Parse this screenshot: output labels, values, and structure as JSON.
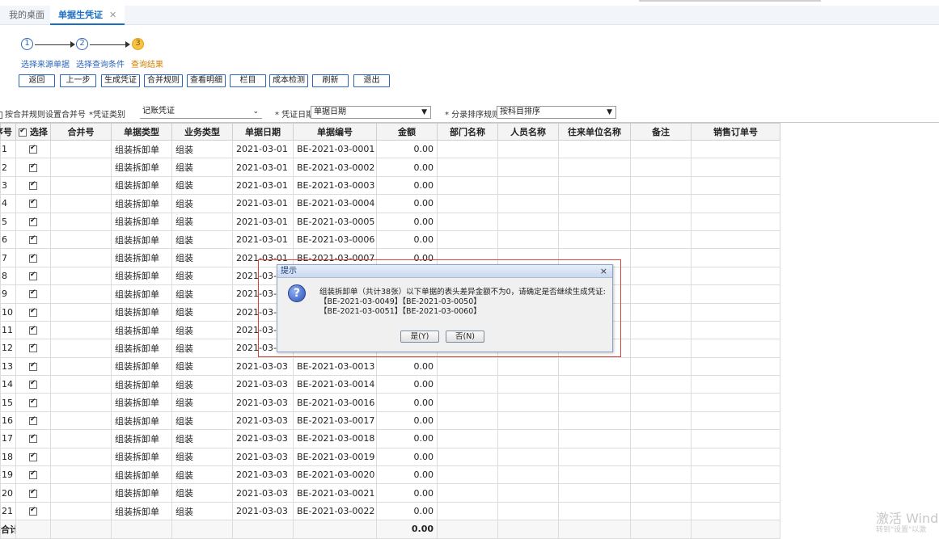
{
  "tabs": [
    {
      "label": "我的桌面"
    },
    {
      "label": "单据生凭证",
      "close": "✕"
    }
  ],
  "steps": [
    {
      "num": "1",
      "label": "选择来源单据"
    },
    {
      "num": "2",
      "label": "选择查询条件"
    },
    {
      "num": "3",
      "label": "查询结果"
    }
  ],
  "toolbar": {
    "back": "返回",
    "prev": "上一步",
    "generate": "生成凭证",
    "merge_rule": "合并规则",
    "view_detail": "查看明细",
    "columns": "栏目",
    "cost_check": "成本检测",
    "refresh": "刷新",
    "exit": "退出"
  },
  "filters": {
    "merge_label": "按合并规则设置合并号",
    "voucher_type_label": "*凭证类别",
    "voucher_type_value": "记账凭证",
    "voucher_date_label": "* 凭证日期",
    "voucher_date_value": "单据日期",
    "sort_label": "* 分录排序规则",
    "sort_value": "按科目排序"
  },
  "table": {
    "headers": [
      "序号",
      "选择",
      "合并号",
      "单据类型",
      "业务类型",
      "单据日期",
      "单据编号",
      "金额",
      "部门名称",
      "人员名称",
      "往来单位名称",
      "备注",
      "销售订单号"
    ],
    "rows": [
      {
        "no": "1",
        "type": "组装拆卸单",
        "biz": "组装",
        "date": "2021-03-01",
        "code": "BE-2021-03-0001",
        "amount": "0.00"
      },
      {
        "no": "2",
        "type": "组装拆卸单",
        "biz": "组装",
        "date": "2021-03-01",
        "code": "BE-2021-03-0002",
        "amount": "0.00"
      },
      {
        "no": "3",
        "type": "组装拆卸单",
        "biz": "组装",
        "date": "2021-03-01",
        "code": "BE-2021-03-0003",
        "amount": "0.00"
      },
      {
        "no": "4",
        "type": "组装拆卸单",
        "biz": "组装",
        "date": "2021-03-01",
        "code": "BE-2021-03-0004",
        "amount": "0.00"
      },
      {
        "no": "5",
        "type": "组装拆卸单",
        "biz": "组装",
        "date": "2021-03-01",
        "code": "BE-2021-03-0005",
        "amount": "0.00"
      },
      {
        "no": "6",
        "type": "组装拆卸单",
        "biz": "组装",
        "date": "2021-03-01",
        "code": "BE-2021-03-0006",
        "amount": "0.00"
      },
      {
        "no": "7",
        "type": "组装拆卸单",
        "biz": "组装",
        "date": "2021-03-01",
        "code": "BE-2021-03-0007",
        "amount": "0.00"
      },
      {
        "no": "8",
        "type": "组装拆卸单",
        "biz": "组装",
        "date": "2021-03-02",
        "code": "",
        "amount": ""
      },
      {
        "no": "9",
        "type": "组装拆卸单",
        "biz": "组装",
        "date": "2021-03-02",
        "code": "",
        "amount": ""
      },
      {
        "no": "10",
        "type": "组装拆卸单",
        "biz": "组装",
        "date": "2021-03-02",
        "code": "",
        "amount": ""
      },
      {
        "no": "11",
        "type": "组装拆卸单",
        "biz": "组装",
        "date": "2021-03-07",
        "code": "",
        "amount": ""
      },
      {
        "no": "12",
        "type": "组装拆卸单",
        "biz": "组装",
        "date": "2021-03-02",
        "code": "",
        "amount": ""
      },
      {
        "no": "13",
        "type": "组装拆卸单",
        "biz": "组装",
        "date": "2021-03-03",
        "code": "BE-2021-03-0013",
        "amount": "0.00"
      },
      {
        "no": "14",
        "type": "组装拆卸单",
        "biz": "组装",
        "date": "2021-03-03",
        "code": "BE-2021-03-0014",
        "amount": "0.00"
      },
      {
        "no": "15",
        "type": "组装拆卸单",
        "biz": "组装",
        "date": "2021-03-03",
        "code": "BE-2021-03-0016",
        "amount": "0.00"
      },
      {
        "no": "16",
        "type": "组装拆卸单",
        "biz": "组装",
        "date": "2021-03-03",
        "code": "BE-2021-03-0017",
        "amount": "0.00"
      },
      {
        "no": "17",
        "type": "组装拆卸单",
        "biz": "组装",
        "date": "2021-03-03",
        "code": "BE-2021-03-0018",
        "amount": "0.00"
      },
      {
        "no": "18",
        "type": "组装拆卸单",
        "biz": "组装",
        "date": "2021-03-03",
        "code": "BE-2021-03-0019",
        "amount": "0.00"
      },
      {
        "no": "19",
        "type": "组装拆卸单",
        "biz": "组装",
        "date": "2021-03-03",
        "code": "BE-2021-03-0020",
        "amount": "0.00"
      },
      {
        "no": "20",
        "type": "组装拆卸单",
        "biz": "组装",
        "date": "2021-03-03",
        "code": "BE-2021-03-0021",
        "amount": "0.00"
      },
      {
        "no": "21",
        "type": "组装拆卸单",
        "biz": "组装",
        "date": "2021-03-03",
        "code": "BE-2021-03-0022",
        "amount": "0.00"
      }
    ],
    "total_label": "合计",
    "total_amount": "0.00"
  },
  "dialog": {
    "title": "提示",
    "close": "×",
    "icon": "question-icon",
    "line1": "组装拆卸单（共计38张）以下单据的表头差异金额不为0，请确定是否继续生成凭证:",
    "line2": "【BE-2021-03-0049】【BE-2021-03-0050】",
    "line3": "【BE-2021-03-0051】【BE-2021-03-0060】",
    "yes": "是(Y)",
    "no": "否(N)"
  },
  "watermark": {
    "line1": "激活 Windo",
    "line2": "转到\"设置\"以激"
  }
}
